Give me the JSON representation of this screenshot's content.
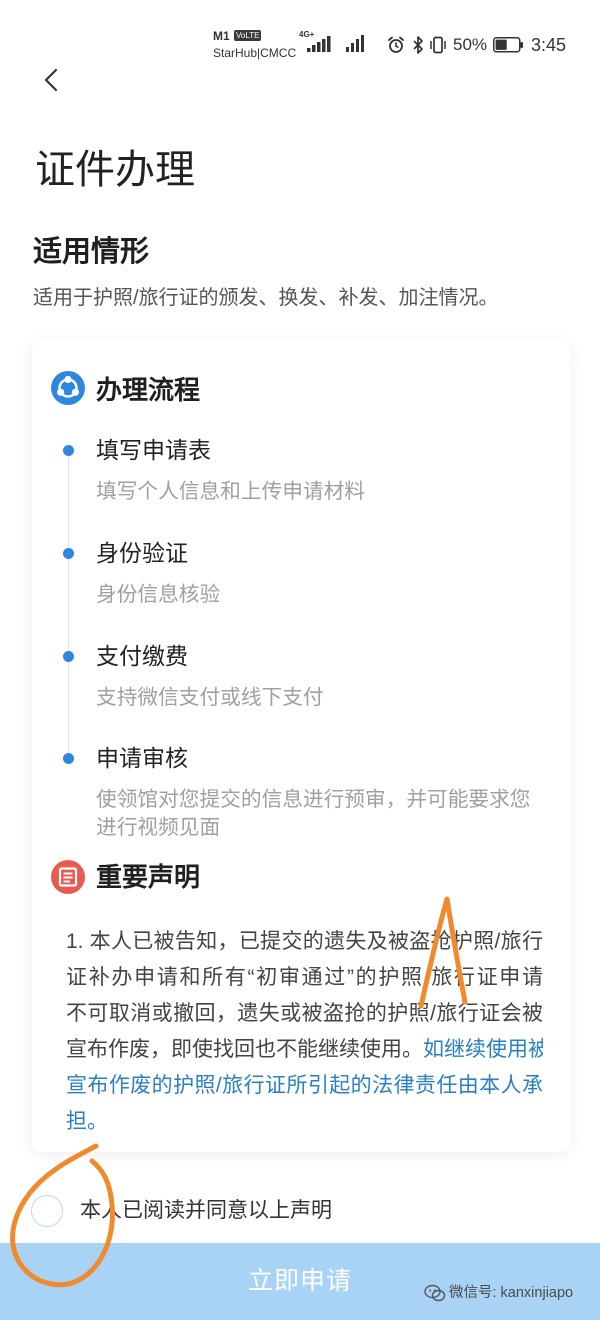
{
  "status_bar": {
    "carrier_primary": "M1",
    "volte_badge": "VoLTE",
    "carrier_secondary": "StarHub|CMCC",
    "network_badge": "4G+",
    "icons": [
      "signal-icon",
      "signal-icon",
      "alarm-icon",
      "bluetooth-icon",
      "vibrate-icon",
      "battery-icon"
    ],
    "battery_text": "50%",
    "battery_level": 0.5,
    "time": "3:45"
  },
  "header": {
    "back_icon": "chevron-left-icon"
  },
  "page_title": "证件办理",
  "applicable_section": {
    "heading": "适用情形",
    "description": "适用于护照/旅行证的颁发、换发、补发、加注情况。"
  },
  "process_section": {
    "icon": "process-icon",
    "heading": "办理流程",
    "steps": [
      {
        "title": "填写申请表",
        "desc": "填写个人信息和上传申请材料"
      },
      {
        "title": "身份验证",
        "desc": "身份信息核验"
      },
      {
        "title": "支付缴费",
        "desc": "支持微信支付或线下支付"
      },
      {
        "title": "申请审核",
        "desc": "使领馆对您提交的信息进行预审，并可能要求您进行视频见面"
      }
    ]
  },
  "declaration_section": {
    "icon": "notice-icon",
    "heading": "重要声明",
    "lines": [
      {
        "text": "1. 本人已被告知，已提交的遗失及被盗抢护照/旅行"
      },
      {
        "text": "证补办申请和所有“初审通过”的护照/旅行证申请"
      },
      {
        "text": "不可取消或撤回，遗失或被盗抢的护照/旅行证会被"
      },
      {
        "text": "宣布作废，即使找回也不能继续使用。",
        "highlight": "如继续使用被"
      },
      {
        "highlight": "宣布作废的护照/旅行证所引起的法律责任由本人承"
      },
      {
        "highlight": "担。"
      }
    ]
  },
  "agreement": {
    "label": "本人已阅读并同意以上声明",
    "checked": false
  },
  "submit_button": {
    "label": "立即申请",
    "enabled": false
  },
  "watermark": {
    "icon": "wechat-icon",
    "text": "微信号: kanxinjiapo"
  },
  "colors": {
    "primary_blue": "#2f86e0",
    "highlight_blue": "#2a80c4",
    "notice_red": "#e85a52",
    "button_disabled": "#a8d3f5",
    "annotation_orange": "#f08a2c"
  }
}
